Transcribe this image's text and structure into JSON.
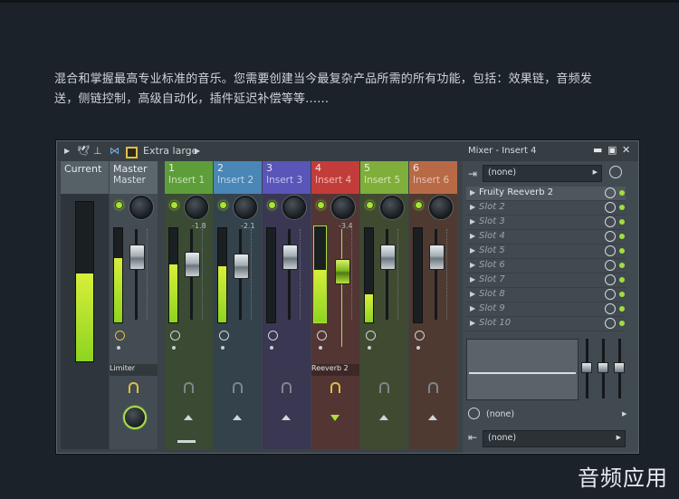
{
  "intro_text": "混合和掌握最高专业标准的音乐。您需要创建当今最复杂产品所需的所有功能，包括：效果链，音频发送，侧链控制，高级自动化，插件延迟补偿等等......",
  "watermark": "音频应用",
  "toolbar": {
    "size_label": "Extra large"
  },
  "strips": [
    {
      "num": "",
      "name": "Current",
      "color": "#566067"
    },
    {
      "num": "",
      "name": "Master",
      "sub": "Master",
      "color": "#5c666d"
    },
    {
      "num": "1",
      "name": "Insert 1",
      "color": "#5e9e3a",
      "db": "-1.8"
    },
    {
      "num": "2",
      "name": "Insert 2",
      "color": "#4a86b6",
      "db": "-2.1"
    },
    {
      "num": "3",
      "name": "Insert 3",
      "color": "#5a55b8",
      "db": ""
    },
    {
      "num": "4",
      "name": "Insert 4",
      "color": "#c23d3a",
      "db": "-3.4"
    },
    {
      "num": "5",
      "name": "Insert 5",
      "color": "#7fae3a",
      "db": ""
    },
    {
      "num": "6",
      "name": "Insert 6",
      "color": "#b86a47",
      "db": ""
    }
  ],
  "fx_labels": {
    "master": "Limiter",
    "insert4": "Reeverb 2"
  },
  "right_panel": {
    "title": "Mixer - Insert 4",
    "input_select": "(none)",
    "slots": [
      "Fruity Reeverb 2",
      "Slot 2",
      "Slot 3",
      "Slot 4",
      "Slot 5",
      "Slot 6",
      "Slot 7",
      "Slot 8",
      "Slot 9",
      "Slot 10"
    ],
    "send_select": "(none)",
    "output_select": "(none)"
  },
  "colors": {
    "accent": "#a8e23a"
  }
}
